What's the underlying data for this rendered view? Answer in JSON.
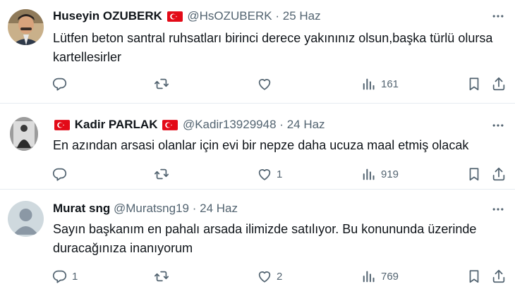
{
  "tweets": [
    {
      "name": "Huseyin OZUBERK",
      "handle": "@HsOZUBERK",
      "dot": "·",
      "date": "25 Haz",
      "text": "Lütfen beton santral ruhsatları birinci derece yakınınız olsun,başka türlü olursa kartellesirler",
      "replies": "",
      "retweets": "",
      "likes": "",
      "views": "161"
    },
    {
      "name": "Kadir PARLAK",
      "handle": "@Kadir13929948",
      "dot": "·",
      "date": "24 Haz",
      "text": "En azından arsasi olanlar için evi bir nepze daha ucuza maal etmiş olacak",
      "replies": "",
      "retweets": "",
      "likes": "1",
      "views": "919"
    },
    {
      "name": "Murat sng",
      "handle": "@Muratsng19",
      "dot": "·",
      "date": "24 Haz",
      "text": "Sayın başkanım en pahalı arsada ilimizde satılıyor. Bu konunundа üzerinde duracağınıza inanıyorum",
      "replies": "1",
      "retweets": "",
      "likes": "2",
      "views": "769"
    }
  ],
  "colors": {
    "text": "#0f1419",
    "muted": "#536471",
    "flag_red": "#e30a17",
    "separator": "#e6ecf0"
  },
  "icons": [
    "reply-icon",
    "retweet-icon",
    "like-icon",
    "views-icon",
    "bookmark-icon",
    "share-icon",
    "more-icon",
    "turkey-flag-icon"
  ]
}
